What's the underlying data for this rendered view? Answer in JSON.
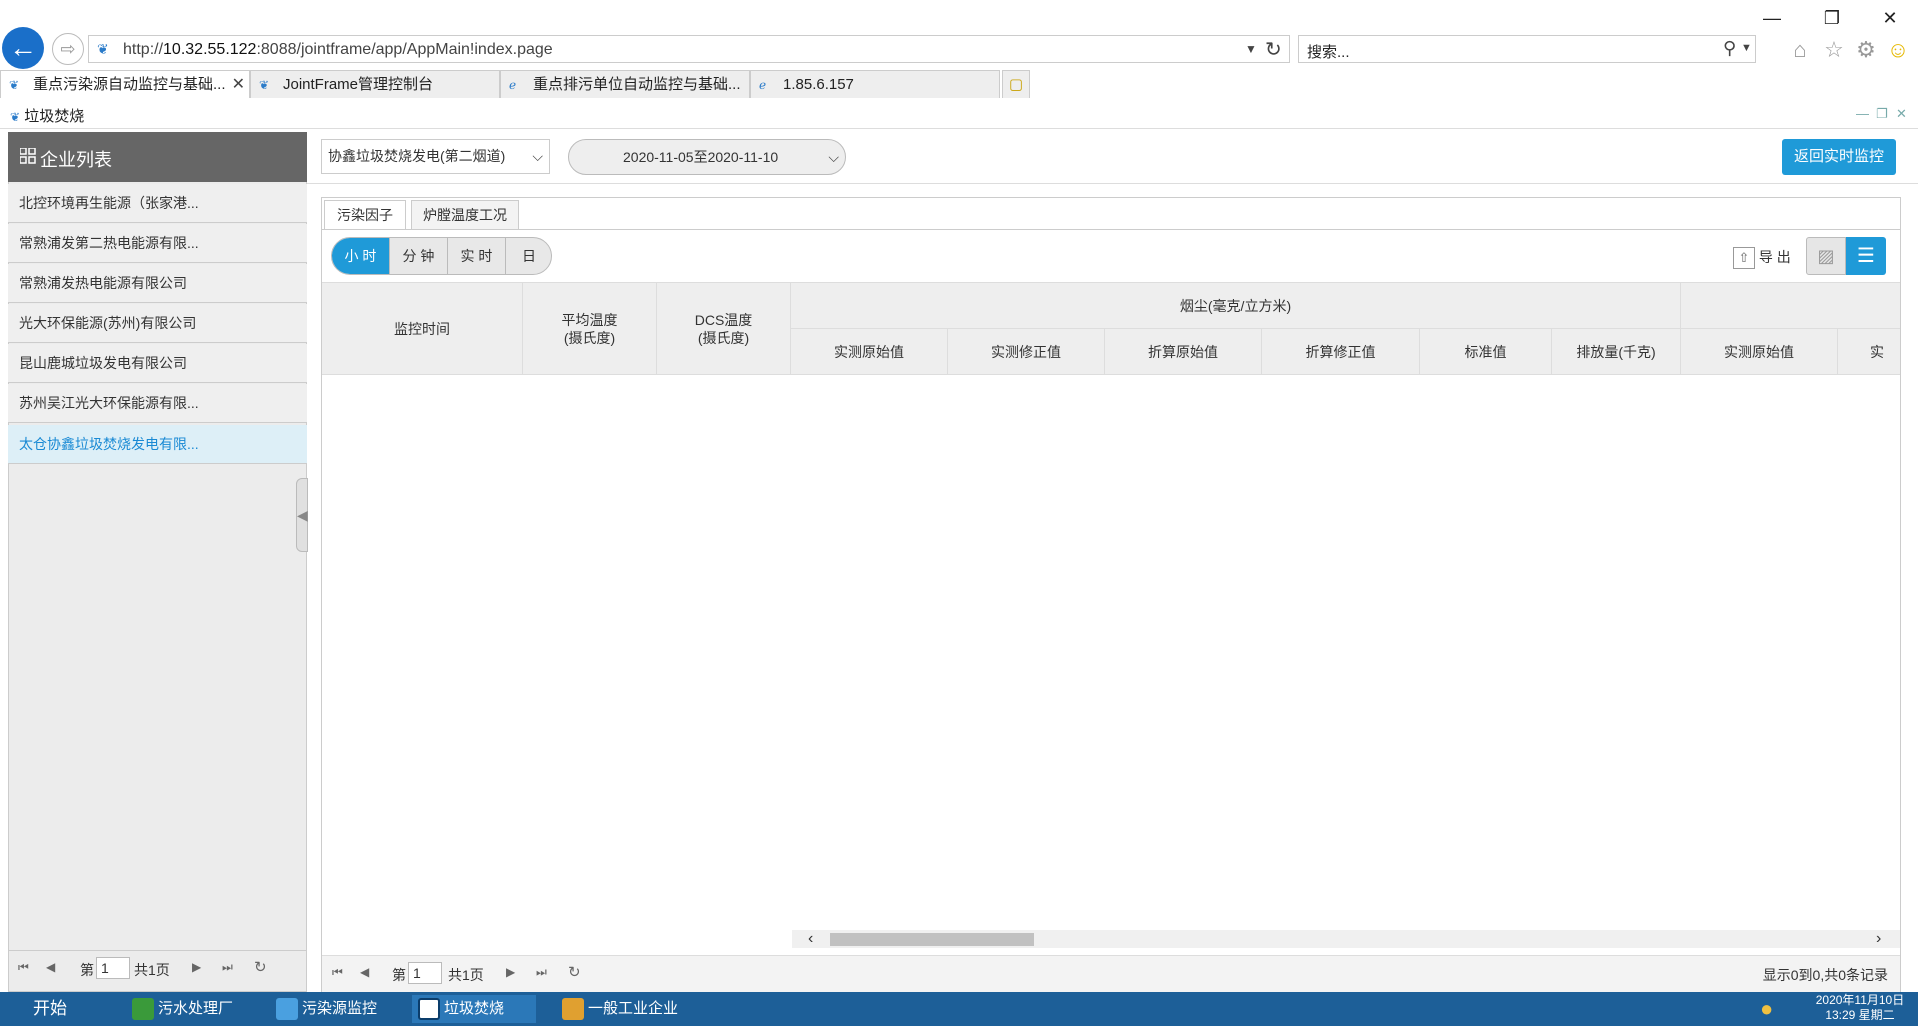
{
  "browser": {
    "window_controls": {
      "minimize": "—",
      "restore": "❐",
      "close": "✕"
    },
    "address": {
      "prefix": "http://",
      "host": "10.32.55.122",
      "path": ":8088/jointframe/app/AppMain!index.page"
    },
    "search_placeholder": "搜索...",
    "tabs": [
      {
        "label": "重点污染源自动监控与基础...",
        "active": true
      },
      {
        "label": "JointFrame管理控制台",
        "active": false
      },
      {
        "label": "重点排污单位自动监控与基础...",
        "active": false
      },
      {
        "label": "1.85.6.157",
        "active": false
      }
    ]
  },
  "app": {
    "title": "垃圾焚烧",
    "sidebar": {
      "header": "企业列表",
      "items": [
        {
          "label": "北控环境再生能源（张家港..."
        },
        {
          "label": "常熟浦发第二热电能源有限..."
        },
        {
          "label": "常熟浦发热电能源有限公司"
        },
        {
          "label": "光大环保能源(苏州)有限公司"
        },
        {
          "label": "昆山鹿城垃圾发电有限公司"
        },
        {
          "label": "苏州吴江光大环保能源有限..."
        },
        {
          "label": "太仓协鑫垃圾焚烧发电有限...",
          "selected": true
        }
      ],
      "pager": {
        "page_prefix": "第",
        "page_value": "1",
        "total": "共1页"
      }
    },
    "toolbar": {
      "outlet_select": "协鑫垃圾焚烧发电(第二烟道)",
      "date_range": "2020-11-05至2020-11-10",
      "back_button": "返回实时监控"
    },
    "subtabs": [
      "污染因子",
      "炉膛温度工况"
    ],
    "granularity": [
      {
        "label": "小 时",
        "active": true
      },
      {
        "label": "分 钟",
        "active": false
      },
      {
        "label": "实 时",
        "active": false
      },
      {
        "label": "日",
        "active": false
      }
    ],
    "export_label": "导 出",
    "table": {
      "col_time": "监控时间",
      "col_avg_temp": [
        "平均温度",
        "(摄氏度)"
      ],
      "col_dcs_temp": [
        "DCS温度",
        "(摄氏度)"
      ],
      "group_dust": "烟尘(毫克/立方米)",
      "sub_cols": [
        "实测原始值",
        "实测修正值",
        "折算原始值",
        "折算修正值",
        "标准值",
        "排放量(千克)",
        "实测原始值",
        "实"
      ]
    },
    "pager": {
      "page_prefix": "第",
      "page_value": "1",
      "total": "共1页",
      "summary": "显示0到0,共0条记录"
    }
  },
  "taskbar": {
    "start": "开始",
    "items": [
      "污水处理厂",
      "污染源监控",
      "垃圾焚烧",
      "一般工业企业"
    ],
    "date": "2020年11月10日",
    "time": "13:29 星期二"
  },
  "colors": {
    "accent": "#1f9ad8",
    "sidebar_header": "#666666",
    "selected_row": "#ddeff7",
    "taskbar": "#1d5f98"
  }
}
